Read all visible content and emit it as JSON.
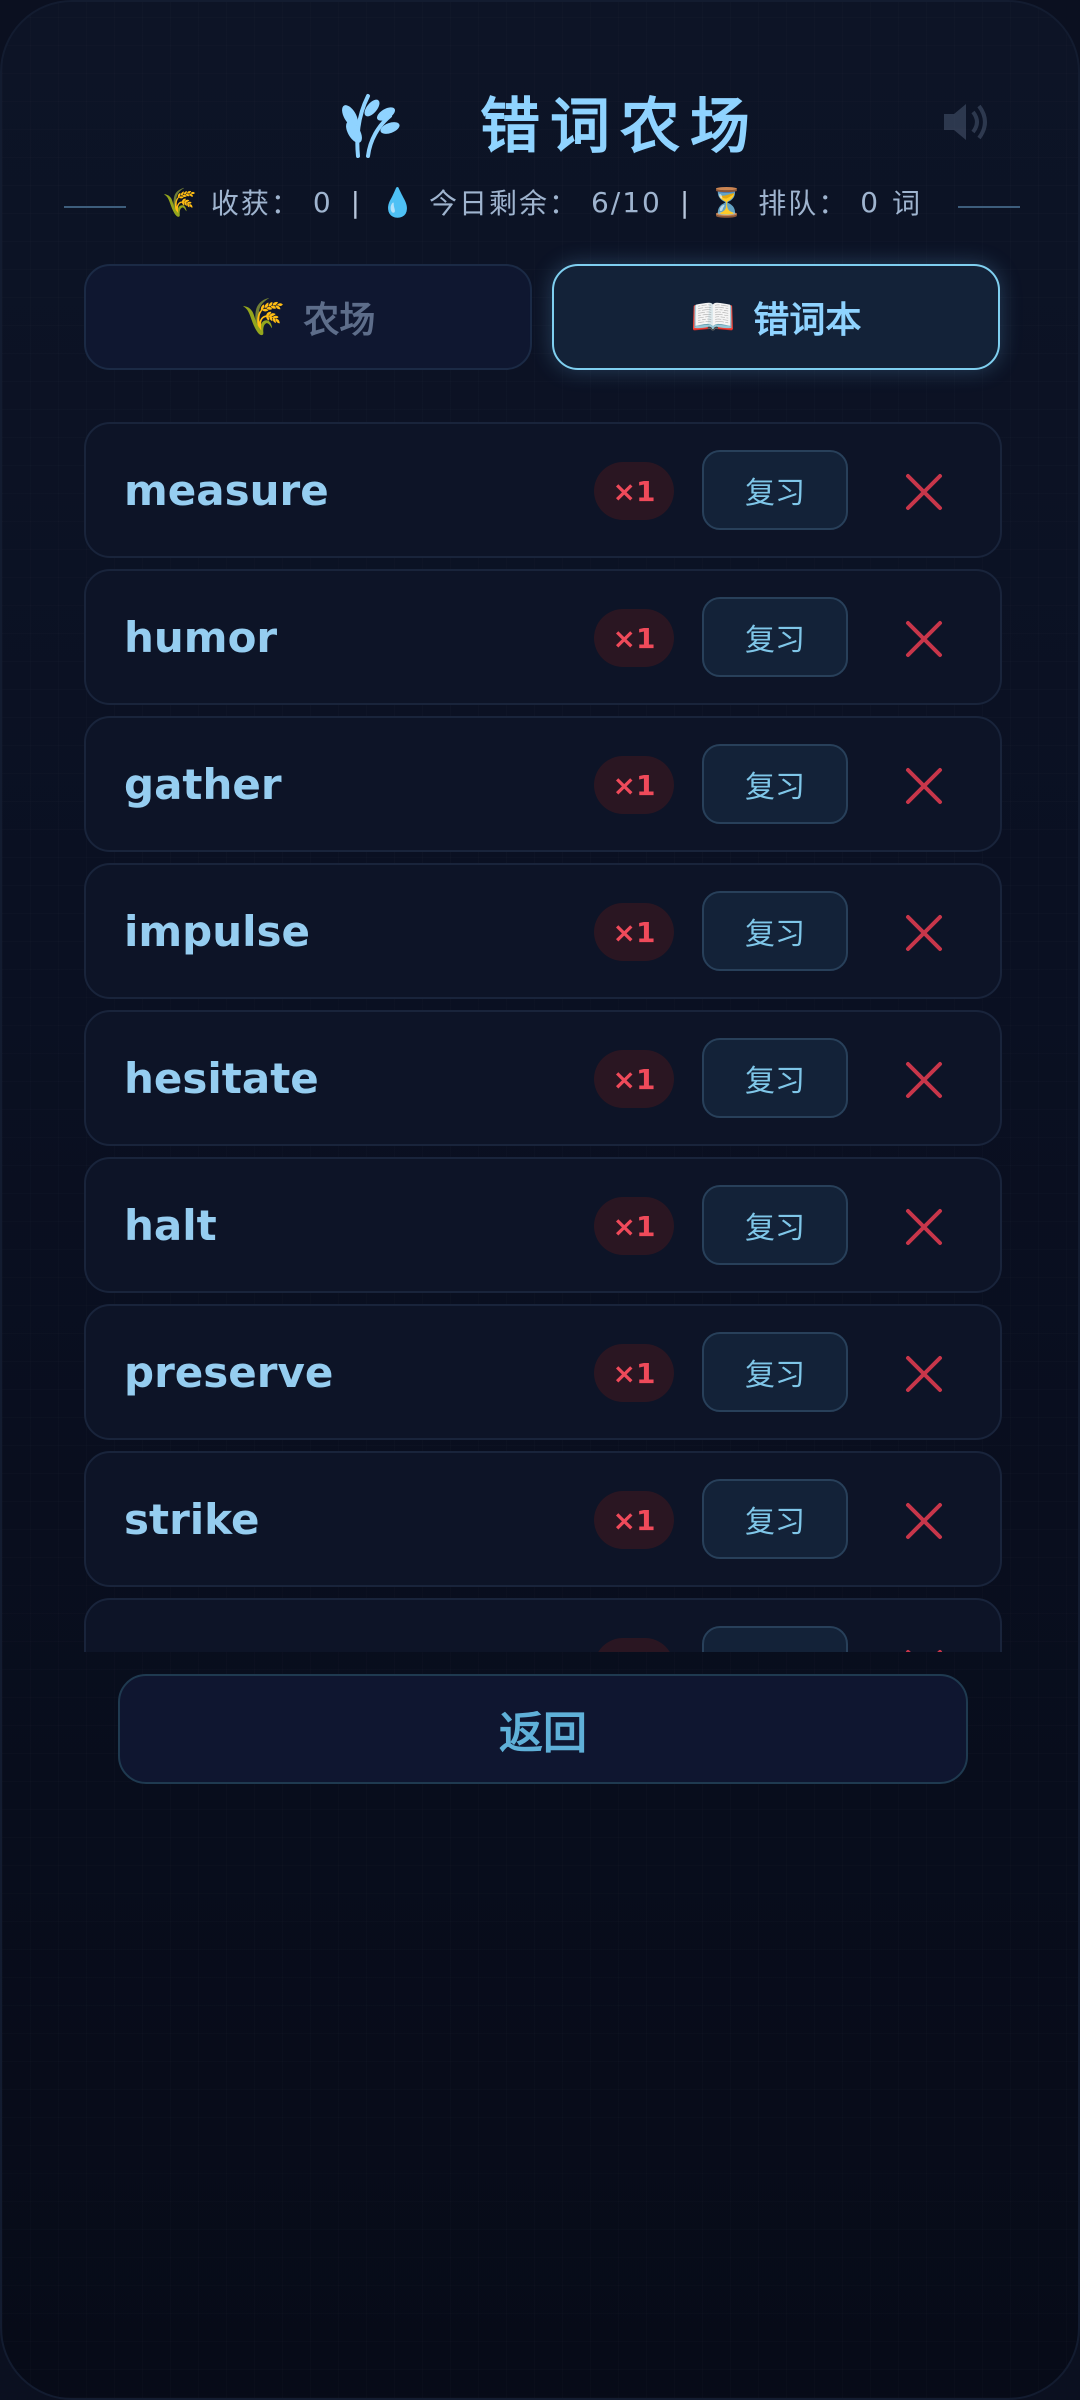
{
  "header": {
    "logo_icon": "wheat-icon",
    "title": "错词农场",
    "sound_icon": "speaker-icon"
  },
  "stats": {
    "harvest_label": "收获：",
    "harvest_value": "0",
    "remaining_label": "今日剩余：",
    "remaining_value": "6/10",
    "queue_label": "排队：",
    "queue_value": "0",
    "queue_unit": "词",
    "separator": "|"
  },
  "tabs": [
    {
      "icon": "wheat-icon",
      "label": "农场",
      "active": false
    },
    {
      "icon": "open-book-icon",
      "label": "错词本",
      "active": true
    }
  ],
  "words": [
    {
      "word": "measure",
      "count": "×1",
      "review_label": "复习"
    },
    {
      "word": "humor",
      "count": "×1",
      "review_label": "复习"
    },
    {
      "word": "gather",
      "count": "×1",
      "review_label": "复习"
    },
    {
      "word": "impulse",
      "count": "×1",
      "review_label": "复习"
    },
    {
      "word": "hesitate",
      "count": "×1",
      "review_label": "复习"
    },
    {
      "word": "halt",
      "count": "×1",
      "review_label": "复习"
    },
    {
      "word": "preserve",
      "count": "×1",
      "review_label": "复习"
    },
    {
      "word": "strike",
      "count": "×1",
      "review_label": "复习"
    },
    {
      "word": "",
      "count": "",
      "review_label": ""
    }
  ],
  "back_label": "返回",
  "colors": {
    "accent": "#8fd3ff",
    "danger": "#ef4a5a",
    "background": "#0b1020"
  }
}
